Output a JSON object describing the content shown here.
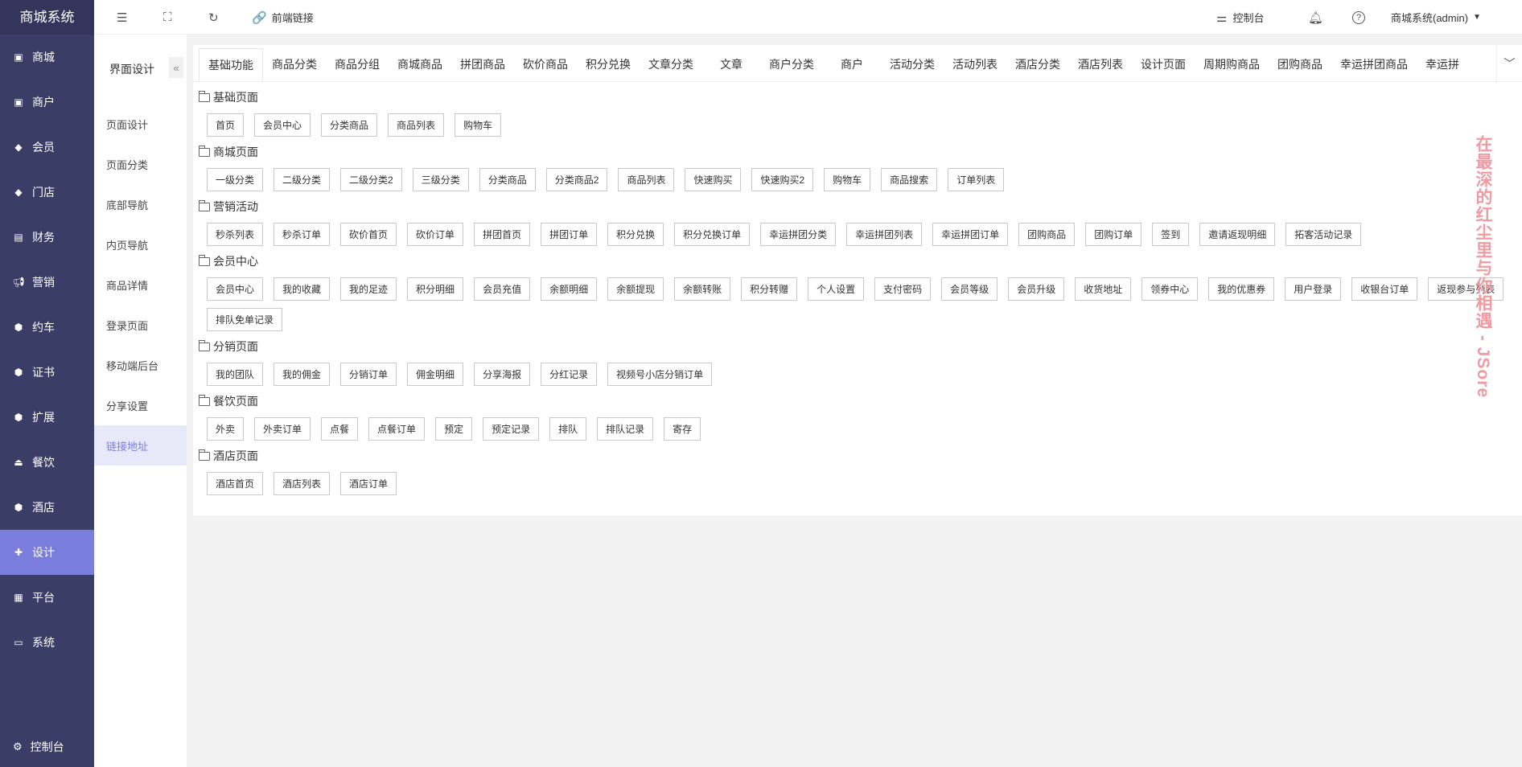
{
  "app": {
    "brand": "商城系统"
  },
  "sidebar": {
    "items": [
      {
        "label": "商城",
        "icon": "bag-icon"
      },
      {
        "label": "商户",
        "icon": "bag-icon"
      },
      {
        "label": "会员",
        "icon": "diamond-icon"
      },
      {
        "label": "门店",
        "icon": "diamond-icon"
      },
      {
        "label": "财务",
        "icon": "ledger-icon"
      },
      {
        "label": "营销",
        "icon": "megaphone-icon"
      },
      {
        "label": "约车",
        "icon": "cube-icon"
      },
      {
        "label": "证书",
        "icon": "cube-icon"
      },
      {
        "label": "扩展",
        "icon": "cube-icon"
      },
      {
        "label": "餐饮",
        "icon": "cloche-icon"
      },
      {
        "label": "酒店",
        "icon": "cube-icon"
      },
      {
        "label": "设计",
        "icon": "puzzle-icon",
        "active": true
      },
      {
        "label": "平台",
        "icon": "grid-icon"
      },
      {
        "label": "系统",
        "icon": "monitor-icon"
      }
    ],
    "console": "控制台"
  },
  "topbar": {
    "frontend_link": "前端链接",
    "console": "控制台",
    "user": "商城系统(admin)"
  },
  "submenu": {
    "title": "界面设计",
    "items": [
      "页面设计",
      "页面分类",
      "底部导航",
      "内页导航",
      "商品详情",
      "登录页面",
      "移动端后台",
      "分享设置",
      "链接地址"
    ],
    "active_index": 8
  },
  "tabs": [
    "基础功能",
    "商品分类",
    "商品分组",
    "商城商品",
    "拼团商品",
    "砍价商品",
    "积分兑换",
    "文章分类",
    "文章",
    "商户分类",
    "商户",
    "活动分类",
    "活动列表",
    "酒店分类",
    "酒店列表",
    "设计页面",
    "周期购商品",
    "团购商品",
    "幸运拼团商品",
    "幸运拼"
  ],
  "sections": [
    {
      "title": "基础页面",
      "links": [
        "首页",
        "会员中心",
        "分类商品",
        "商品列表",
        "购物车"
      ]
    },
    {
      "title": "商城页面",
      "links": [
        "一级分类",
        "二级分类",
        "二级分类2",
        "三级分类",
        "分类商品",
        "分类商品2",
        "商品列表",
        "快速购买",
        "快速购买2",
        "购物车",
        "商品搜索",
        "订单列表"
      ]
    },
    {
      "title": "营销活动",
      "links": [
        "秒杀列表",
        "秒杀订单",
        "砍价首页",
        "砍价订单",
        "拼团首页",
        "拼团订单",
        "积分兑换",
        "积分兑换订单",
        "幸运拼团分类",
        "幸运拼团列表",
        "幸运拼团订单",
        "团购商品",
        "团购订单",
        "签到",
        "邀请返现明细",
        "拓客活动记录"
      ]
    },
    {
      "title": "会员中心",
      "links": [
        "会员中心",
        "我的收藏",
        "我的足迹",
        "积分明细",
        "会员充值",
        "余额明细",
        "余额提现",
        "余额转账",
        "积分转赠",
        "个人设置",
        "支付密码",
        "会员等级",
        "会员升级",
        "收货地址",
        "领券中心",
        "我的优惠券",
        "用户登录",
        "收银台订单",
        "返现参与列表",
        "排队免单记录"
      ]
    },
    {
      "title": "分销页面",
      "links": [
        "我的团队",
        "我的佣金",
        "分销订单",
        "佣金明细",
        "分享海报",
        "分红记录",
        "视频号小店分销订单"
      ]
    },
    {
      "title": "餐饮页面",
      "links": [
        "外卖",
        "外卖订单",
        "点餐",
        "点餐订单",
        "预定",
        "预定记录",
        "排队",
        "排队记录",
        "寄存"
      ]
    },
    {
      "title": "酒店页面",
      "links": [
        "酒店首页",
        "酒店列表",
        "酒店订单"
      ]
    }
  ],
  "watermark": "在最深的红尘里与你相遇 - JSore",
  "colors": {
    "sidebar": "#3a3d66",
    "accent": "#7b7ddc",
    "watermark": "#f09aa2"
  }
}
